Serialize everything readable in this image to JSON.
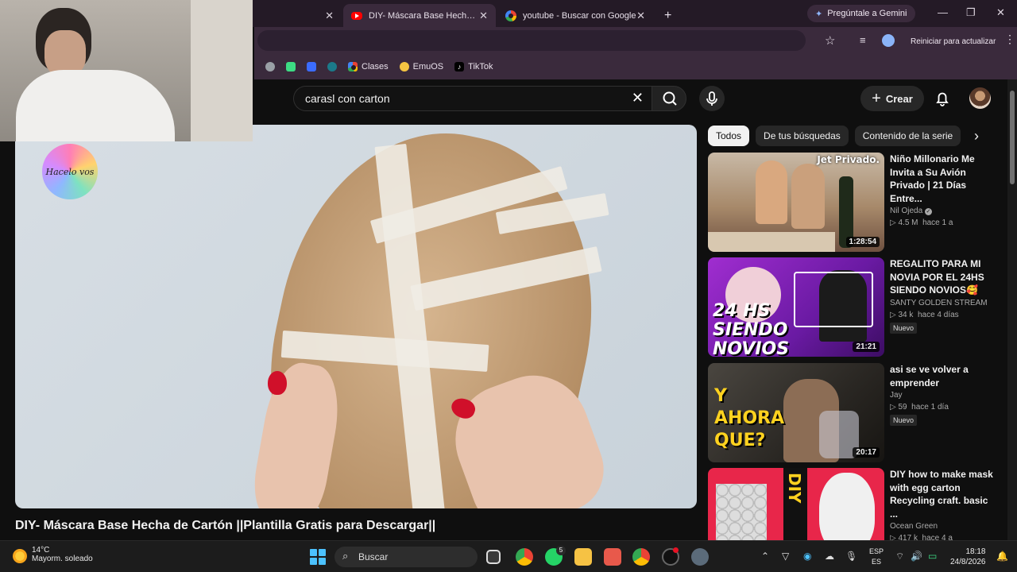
{
  "browser": {
    "tabs": [
      {
        "title": "",
        "active": false
      },
      {
        "title": "DIY- Máscara Base Hecha de Ca",
        "active": true
      },
      {
        "title": "youtube - Buscar con Google",
        "active": false
      }
    ],
    "gemini_label": "Pregúntale a Gemini",
    "update_label": "Reiniciar para actualizar",
    "bookmarks": [
      "Clases",
      "EmuOS",
      "TikTok"
    ]
  },
  "youtube": {
    "search_query": "carasl con carton",
    "create_label": "Crear",
    "video_title": "DIY- Máscara Base Hecha de Cartón ||Plantilla Gratis para Descargar||",
    "channel_logo_text": "Hacelo vos",
    "chips": [
      "Todos",
      "De tus búsquedas",
      "Contenido de la serie"
    ],
    "recommendations": [
      {
        "title": "Niño Millonario Me Invita a Su Avión Privado | 21 Días Entre...",
        "channel": "Nil Ojeda",
        "verified": true,
        "views": "4.5 M",
        "age": "hace 1 a",
        "duration": "1:28:54",
        "badge": "",
        "thumb_text": "Jet Privado."
      },
      {
        "title": "REGALITO PARA MI NOVIA POR EL 24HS SIENDO NOVIOS🥰",
        "channel": "SANTY GOLDEN STREAM",
        "verified": false,
        "views": "34 k",
        "age": "hace 4 días",
        "duration": "21:21",
        "badge": "Nuevo",
        "thumb_text": "24 HS SIENDO NOVIOS"
      },
      {
        "title": "asi se ve volver a emprender",
        "channel": "Jay",
        "verified": false,
        "views": "59",
        "age": "hace 1 día",
        "duration": "20:17",
        "badge": "Nuevo",
        "thumb_text": "Y AHORA QUE?"
      },
      {
        "title": "DIY how to make mask with egg carton Recycling craft. basic ...",
        "channel": "Ocean Green",
        "verified": false,
        "views": "417 k",
        "age": "hace 4 a",
        "duration": "",
        "badge": "",
        "thumb_text": "DIY"
      }
    ]
  },
  "taskbar": {
    "weather_temp": "14°C",
    "weather_desc": "Mayorm. soleado",
    "search_label": "Buscar",
    "whatsapp_badge": "5",
    "lang_top": "ESP",
    "lang_bottom": "ES",
    "time": "18:18",
    "date": "24/8/2026"
  },
  "colors": {
    "yt_red": "#ff0000",
    "accent": "#4cc2ff",
    "page_bg": "#0f0f0f"
  }
}
